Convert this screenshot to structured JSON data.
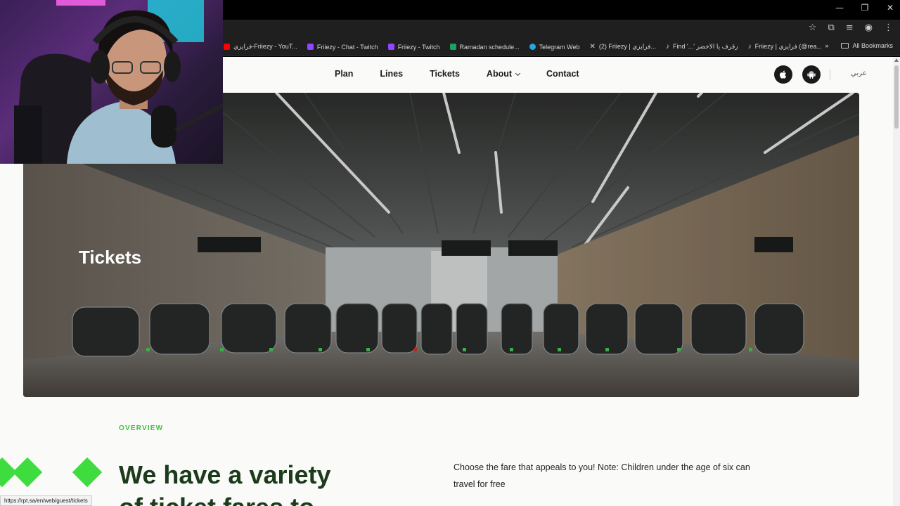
{
  "browser": {
    "bookmarks": [
      {
        "label": "فرايزي-Friiezy - YouT...",
        "color": "#ff0000"
      },
      {
        "label": "Friiezy - Chat - Twitch",
        "color": "#9146ff"
      },
      {
        "label": "Friiezy - Twitch",
        "color": "#9146ff"
      },
      {
        "label": "Ramadan schedule...",
        "color": "#1aa260"
      },
      {
        "label": "Telegram Web",
        "color": "#2aa3df"
      },
      {
        "label": "(2) Friiezy | فرايزي...",
        "color": "#222222"
      },
      {
        "label": "Find '...' زقرف يا الاخضر",
        "color": "#111111"
      },
      {
        "label": "Friiezy | فرايزي (@rea...",
        "color": "#111111"
      }
    ],
    "all_bookmarks": "All Bookmarks",
    "status_url": "https://rpt.sa/en/web/guest/tickets"
  },
  "nav": {
    "links": [
      "Plan",
      "Lines",
      "Tickets",
      "About",
      "Contact"
    ],
    "language": "عربي"
  },
  "hero": {
    "title": "Tickets"
  },
  "section": {
    "overview": "OVERVIEW",
    "headline_1": "We have a variety",
    "headline_2": "of ticket fares to",
    "description": "Choose the fare that appeals to you! Note: Children under the age of six can travel for free"
  },
  "colors": {
    "accent_green": "#3fdc3f",
    "heading_green": "#1c3a1c"
  }
}
